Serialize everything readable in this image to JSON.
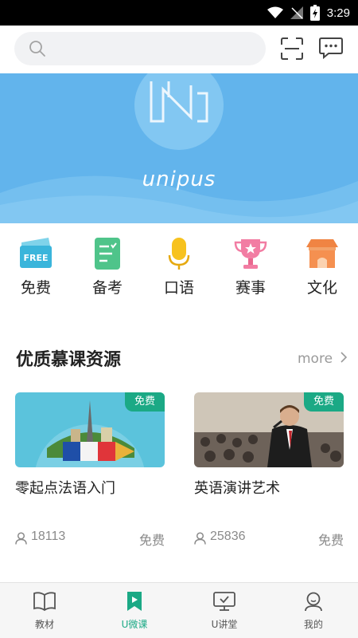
{
  "status_bar": {
    "time": "3:29"
  },
  "search": {
    "placeholder": ""
  },
  "banner": {
    "brand": "unipus"
  },
  "categories": [
    {
      "label": "免费",
      "icon": "free-ticket-icon",
      "badge": "FREE"
    },
    {
      "label": "备考",
      "icon": "checklist-icon"
    },
    {
      "label": "口语",
      "icon": "microphone-icon"
    },
    {
      "label": "赛事",
      "icon": "trophy-icon"
    },
    {
      "label": "文化",
      "icon": "pavilion-icon"
    }
  ],
  "section": {
    "title": "优质慕课资源",
    "more": "more"
  },
  "courses": [
    {
      "title": "零起点法语入门",
      "tag": "免费",
      "count": "18113",
      "price": "免费"
    },
    {
      "title": "英语演讲艺术",
      "tag": "免费",
      "count": "25836",
      "price": "免费"
    }
  ],
  "tabs": [
    {
      "label": "教材",
      "icon": "book-icon",
      "active": false
    },
    {
      "label": "U微课",
      "icon": "play-bookmark-icon",
      "active": true
    },
    {
      "label": "U讲堂",
      "icon": "screen-check-icon",
      "active": false
    },
    {
      "label": "我的",
      "icon": "person-icon",
      "active": false
    }
  ],
  "colors": {
    "accent": "#1ba985",
    "banner": "#62b4ec"
  }
}
